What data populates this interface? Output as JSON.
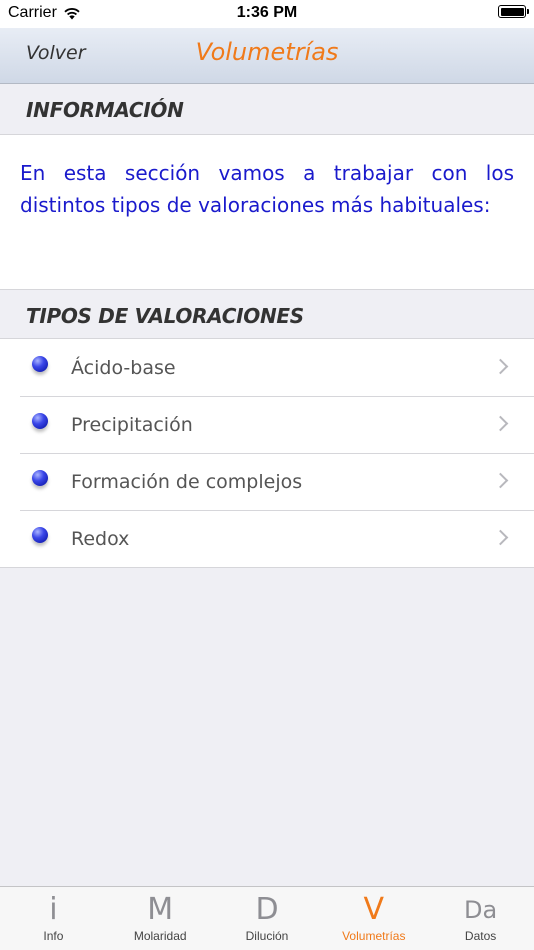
{
  "status_bar": {
    "carrier": "Carrier",
    "time": "1:36 PM"
  },
  "nav": {
    "back_label": "Volver",
    "title": "Volumetrías"
  },
  "info_section": {
    "header": "INFORMACIÓN",
    "text": "En esta sección vamos a trabajar con los distintos tipos de valoraciones más habituales:"
  },
  "types_section": {
    "header": "TIPOS DE VALORACIONES",
    "items": [
      {
        "label": "Ácido-base"
      },
      {
        "label": "Precipitación"
      },
      {
        "label": "Formación de complejos"
      },
      {
        "label": "Redox"
      }
    ]
  },
  "tab_bar": {
    "tabs": [
      {
        "icon": "i",
        "label": "Info"
      },
      {
        "icon": "M",
        "label": "Molaridad"
      },
      {
        "icon": "D",
        "label": "Dilución"
      },
      {
        "icon": "V",
        "label": "Volumetrías"
      },
      {
        "icon": "Da",
        "label": "Datos"
      }
    ]
  },
  "colors": {
    "accent": "#f07a1a",
    "info_text": "#1a1acc",
    "bullet": "#2a35d8"
  }
}
